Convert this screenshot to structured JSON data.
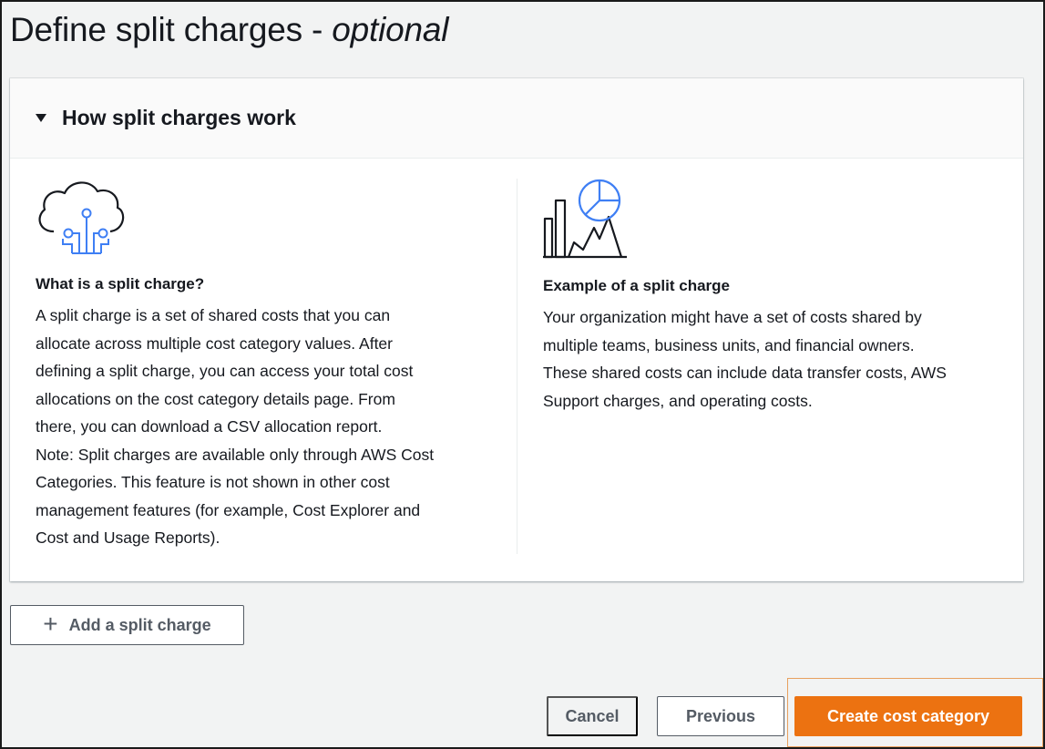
{
  "page": {
    "title": "Define split charges - ",
    "title_suffix": "optional"
  },
  "panel": {
    "header": "How split charges work",
    "left": {
      "icon": "cloud-network-icon",
      "heading": "What is a split charge?",
      "lines": [
        "A split charge is a set of shared costs that you can",
        "allocate across multiple cost category values. After",
        "defining a split charge, you can access your total cost",
        "allocations on the cost category details page. From",
        "there, you can download a CSV allocation report.",
        "Note: Split charges are available only through AWS Cost",
        "Categories. This feature is not shown in other cost",
        "management features (for example, Cost Explorer and",
        "Cost and Usage Reports)."
      ]
    },
    "right": {
      "icon": "chart-analytics-icon",
      "heading": "Example of a split charge",
      "lines": [
        "Your organization might have a set of costs shared by",
        "multiple teams, business units, and financial owners.",
        "These shared costs can include data transfer costs, AWS",
        "Support charges, and operating costs."
      ]
    }
  },
  "actions": {
    "add_split_charge": "Add a split charge",
    "cancel": "Cancel",
    "previous": "Previous",
    "create": "Create cost category"
  },
  "colors": {
    "primary": "#ec7211",
    "accent_blue": "#3f7ff4",
    "text": "#16191f",
    "secondary_text": "#545b64"
  }
}
